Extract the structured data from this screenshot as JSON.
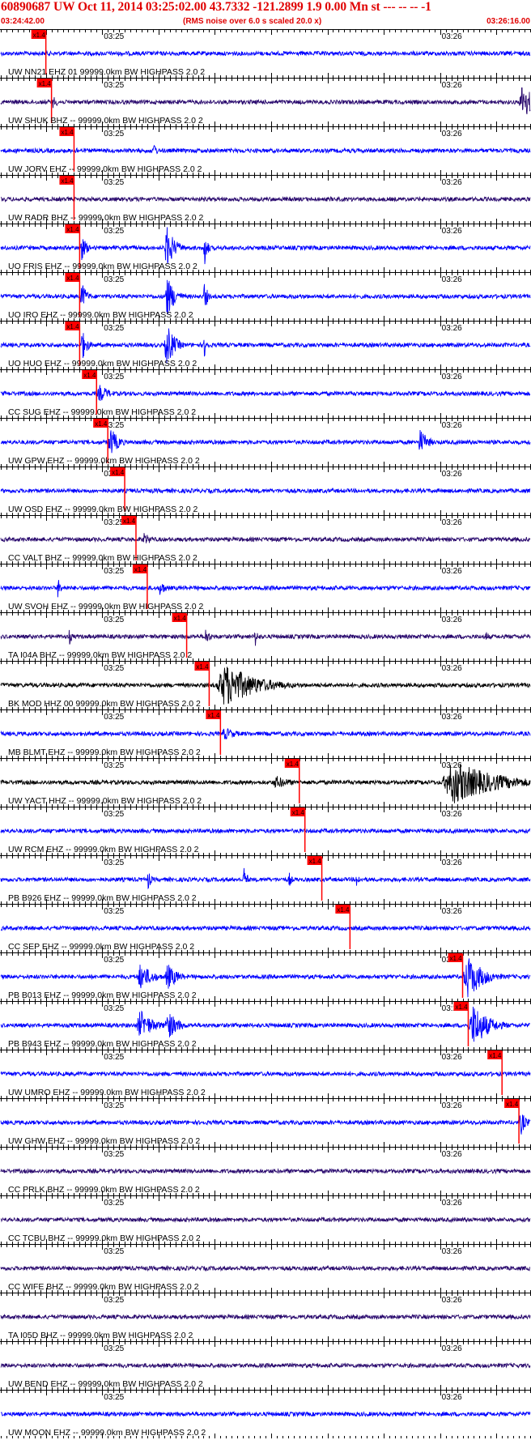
{
  "header": {
    "title": "60890687 UW Oct 11, 2014 03:25:02.00   43.7332 -121.2899  1.9 0.00 Mn st --- -- --  -1",
    "time_start": "03:24:42.00",
    "subtitle": "(RMS noise over 6.0 s scaled 20.0 x)",
    "time_end": "03:26:16.00"
  },
  "chart_data": {
    "type": "line",
    "x_axis": {
      "start": "03:24:42.00",
      "end": "03:26:16.00",
      "major_ticks": [
        "03:25",
        "03:26"
      ]
    },
    "pick_label": "x1.4",
    "colors": {
      "blue": "#0000ff",
      "purple": "#2a0a6e",
      "black": "#000000",
      "pick": "#ff0000"
    },
    "channels": [
      {
        "label": "UW NN21 EHZ 01 99999.0km BW  HIGHPASS  2.0  2",
        "color": "blue",
        "pick": "03:24:50",
        "events": []
      },
      {
        "label": "UW SHUK BHZ -- 99999.0km BW  HIGHPASS  2.0  2",
        "color": "purple",
        "pick": "03:24:51",
        "events": [
          {
            "t": "03:24:51",
            "amp": 0.3,
            "dur": 2
          },
          {
            "t": "03:26:14",
            "amp": 0.9,
            "dur": 4
          }
        ]
      },
      {
        "label": "UW JORV EHZ -- 99999.0km BW  HIGHPASS  2.0  2",
        "color": "blue",
        "pick": "03:24:55",
        "events": [
          {
            "t": "03:24:55",
            "amp": 0.3,
            "dur": 1
          },
          {
            "t": "03:25:09",
            "amp": 0.45,
            "dur": 1
          }
        ]
      },
      {
        "label": "UW RADR BHZ -- 99999.0km BW  HIGHPASS  2.0  2",
        "color": "purple",
        "pick": "03:24:55",
        "events": []
      },
      {
        "label": "UO FRIS EHZ -- 99999.0km BW  HIGHPASS  2.0  2",
        "color": "blue",
        "pick": "03:24:56",
        "events": [
          {
            "t": "03:24:56",
            "amp": 0.6,
            "dur": 2
          },
          {
            "t": "03:25:11",
            "amp": 1.0,
            "dur": 3
          },
          {
            "t": "03:25:18",
            "amp": 0.95,
            "dur": 1
          }
        ]
      },
      {
        "label": "UO IRO EHZ -- 99999.0km BW  HIGHPASS  2.0  2",
        "color": "blue",
        "pick": "03:24:56",
        "events": [
          {
            "t": "03:24:56",
            "amp": 0.7,
            "dur": 2
          },
          {
            "t": "03:25:11",
            "amp": 1.0,
            "dur": 3
          },
          {
            "t": "03:25:18",
            "amp": 0.8,
            "dur": 1
          }
        ]
      },
      {
        "label": "UO HUO EHZ -- 99999.0km BW  HIGHPASS  2.0  2",
        "color": "blue",
        "pick": "03:24:56",
        "events": [
          {
            "t": "03:24:56",
            "amp": 0.8,
            "dur": 2
          },
          {
            "t": "03:25:11",
            "amp": 1.0,
            "dur": 3
          },
          {
            "t": "03:25:18",
            "amp": 0.6,
            "dur": 1
          }
        ]
      },
      {
        "label": "CC SUG EHZ -- 99999.0km BW  HIGHPASS  2.0  2",
        "color": "blue",
        "pick": "03:24:59",
        "events": [
          {
            "t": "03:24:59",
            "amp": 0.4,
            "dur": 4
          }
        ]
      },
      {
        "label": "UW GPW EHZ -- 99999.0km BW  HIGHPASS  2.0  2",
        "color": "blue",
        "pick": "03:25:01",
        "events": [
          {
            "t": "03:25:01",
            "amp": 0.7,
            "dur": 3
          },
          {
            "t": "03:25:56",
            "amp": 0.6,
            "dur": 3
          }
        ]
      },
      {
        "label": "UW OSD EHZ -- 99999.0km BW  HIGHPASS  2.0  2",
        "color": "blue",
        "pick": "03:25:04",
        "events": []
      },
      {
        "label": "CC VALT BHZ -- 99999.0km BW  HIGHPASS  2.0  2",
        "color": "purple",
        "pick": "03:25:06",
        "events": [
          {
            "t": "03:25:07",
            "amp": 0.3,
            "dur": 3
          }
        ]
      },
      {
        "label": "UW SVOH EHZ -- 99999.0km BW  HIGHPASS  2.0  2",
        "color": "blue",
        "pick": "03:25:08",
        "events": [
          {
            "t": "03:24:52",
            "amp": 0.5,
            "dur": 1
          },
          {
            "t": "03:25:10",
            "amp": 0.4,
            "dur": 2
          }
        ]
      },
      {
        "label": "TA I04A BHZ -- 99999.0km BW  HIGHPASS  2.0  2",
        "color": "purple",
        "pick": "03:25:15",
        "events": [
          {
            "t": "03:24:54",
            "amp": 0.4,
            "dur": 1
          },
          {
            "t": "03:25:18",
            "amp": 0.4,
            "dur": 2
          },
          {
            "t": "03:25:27",
            "amp": 0.5,
            "dur": 1
          },
          {
            "t": "03:26:08",
            "amp": 0.3,
            "dur": 1
          }
        ]
      },
      {
        "label": "BK MOD HHZ 00 99999.0km BW  HIGHPASS  2.0  2",
        "color": "black",
        "pick": "03:25:19",
        "events": [
          {
            "t": "03:25:20",
            "amp": 1.0,
            "dur": 12
          }
        ]
      },
      {
        "label": "MB BLMT EHZ -- 99999.0km BW  HIGHPASS  2.0  2",
        "color": "blue",
        "pick": "03:25:21",
        "events": [
          {
            "t": "03:25:21",
            "amp": 0.3,
            "dur": 5
          }
        ]
      },
      {
        "label": "UW YACT HHZ -- 99999.0km BW  HIGHPASS  2.0  2",
        "color": "black",
        "pick": "03:25:35",
        "events": [
          {
            "t": "03:25:30",
            "amp": 0.3,
            "dur": 6
          },
          {
            "t": "03:26:00",
            "amp": 1.0,
            "dur": 16
          }
        ]
      },
      {
        "label": "UW RCM EHZ -- 99999.0km BW  HIGHPASS  2.0  2",
        "color": "blue",
        "pick": "03:25:36",
        "events": []
      },
      {
        "label": "PB B926 EHZ -- 99999.0km BW  HIGHPASS  2.0  2",
        "color": "blue",
        "pick": "03:25:39",
        "events": [
          {
            "t": "03:25:08",
            "amp": 0.5,
            "dur": 1
          },
          {
            "t": "03:25:25",
            "amp": 0.7,
            "dur": 1
          },
          {
            "t": "03:25:33",
            "amp": 0.4,
            "dur": 1
          },
          {
            "t": "03:25:45",
            "amp": 0.4,
            "dur": 1
          }
        ]
      },
      {
        "label": "CC SEP EHZ -- 99999.0km BW  HIGHPASS  2.0  2",
        "color": "blue",
        "pick": "03:25:44",
        "events": []
      },
      {
        "label": "PB B013 EHZ -- 99999.0km BW  HIGHPASS  2.0  2",
        "color": "blue",
        "pick": "03:26:04",
        "events": [
          {
            "t": "03:25:06",
            "amp": 0.6,
            "dur": 5
          },
          {
            "t": "03:25:11",
            "amp": 0.6,
            "dur": 4
          },
          {
            "t": "03:26:04",
            "amp": 1.0,
            "dur": 6
          }
        ]
      },
      {
        "label": "PB B943 EHZ -- 99999.0km BW  HIGHPASS  2.0  2",
        "color": "blue",
        "pick": "03:26:05",
        "events": [
          {
            "t": "03:25:06",
            "amp": 0.7,
            "dur": 5
          },
          {
            "t": "03:25:11",
            "amp": 0.7,
            "dur": 4
          },
          {
            "t": "03:26:05",
            "amp": 1.0,
            "dur": 6
          }
        ]
      },
      {
        "label": "UW UMRO EHZ -- 99999.0km BW  HIGHPASS  2.0  2",
        "color": "blue",
        "pick": "03:26:11",
        "events": []
      },
      {
        "label": "UW GHW EHZ -- 99999.0km BW  HIGHPASS  2.0  2",
        "color": "blue",
        "pick": "03:26:14",
        "events": [
          {
            "t": "03:26:14",
            "amp": 0.6,
            "dur": 2
          }
        ]
      },
      {
        "label": "CC PRLK BHZ -- 99999.0km BW  HIGHPASS  2.0  2",
        "color": "purple",
        "pick": null,
        "events": []
      },
      {
        "label": "CC TCBU BHZ -- 99999.0km BW  HIGHPASS  2.0  2",
        "color": "purple",
        "pick": null,
        "events": []
      },
      {
        "label": "CC WIFE BHZ -- 99999.0km BW  HIGHPASS  2.0  2",
        "color": "purple",
        "pick": null,
        "events": []
      },
      {
        "label": "TA I05D BHZ -- 99999.0km BW  HIGHPASS  2.0  2",
        "color": "purple",
        "pick": null,
        "events": []
      },
      {
        "label": "UW BEND EHZ -- 99999.0km BW  HIGHPASS  2.0  2",
        "color": "purple",
        "pick": null,
        "events": []
      },
      {
        "label": "UW MOON EHZ -- 99999.0km BW  HIGHPASS  2.0  2",
        "color": "blue",
        "pick": null,
        "events": []
      }
    ]
  }
}
